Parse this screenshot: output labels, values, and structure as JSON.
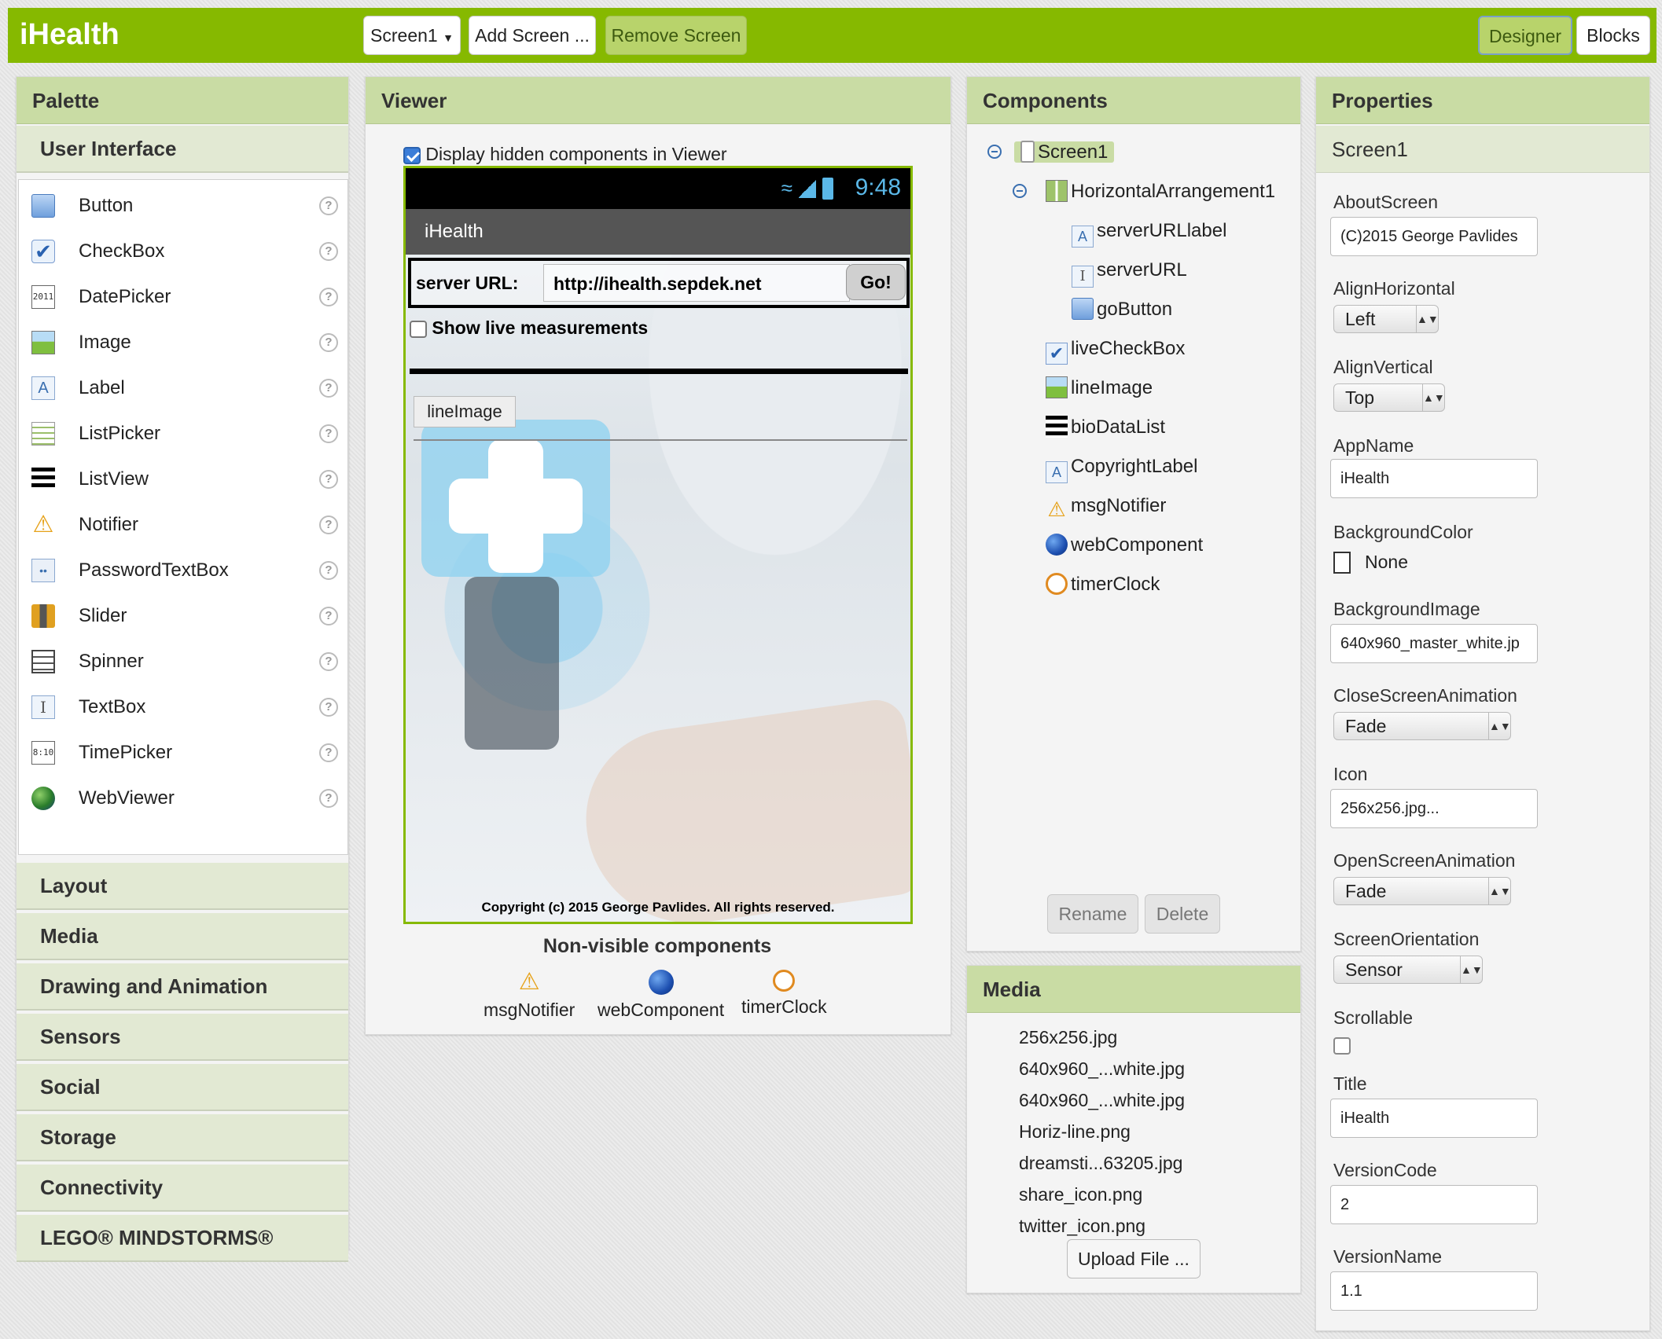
{
  "header": {
    "app_title": "iHealth",
    "screen_dropdown": "Screen1",
    "add_screen": "Add Screen ...",
    "remove_screen": "Remove Screen",
    "designer": "Designer",
    "blocks": "Blocks",
    "bar_color": "#86b900"
  },
  "palette": {
    "title": "Palette",
    "open_category": "User Interface",
    "items": [
      {
        "label": "Button",
        "icon": "button-icon"
      },
      {
        "label": "CheckBox",
        "icon": "checkbox-icon"
      },
      {
        "label": "DatePicker",
        "icon": "datepicker-icon"
      },
      {
        "label": "Image",
        "icon": "image-icon"
      },
      {
        "label": "Label",
        "icon": "label-icon"
      },
      {
        "label": "ListPicker",
        "icon": "listpicker-icon"
      },
      {
        "label": "ListView",
        "icon": "listview-icon"
      },
      {
        "label": "Notifier",
        "icon": "notifier-icon"
      },
      {
        "label": "PasswordTextBox",
        "icon": "password-icon"
      },
      {
        "label": "Slider",
        "icon": "slider-icon"
      },
      {
        "label": "Spinner",
        "icon": "spinner-icon"
      },
      {
        "label": "TextBox",
        "icon": "textbox-icon"
      },
      {
        "label": "TimePicker",
        "icon": "timepicker-icon"
      },
      {
        "label": "WebViewer",
        "icon": "webviewer-icon"
      }
    ],
    "help_glyph": "?",
    "categories": [
      "Layout",
      "Media",
      "Drawing and Animation",
      "Sensors",
      "Social",
      "Storage",
      "Connectivity",
      "LEGO® MINDSTORMS®"
    ]
  },
  "viewer": {
    "title": "Viewer",
    "display_hidden": "Display hidden components in Viewer",
    "phone": {
      "time": "9:48",
      "title": "iHealth",
      "server_label": "server URL:",
      "server_url": "http://ihealth.sepdek.net",
      "go": "Go!",
      "live": "Show live measurements",
      "line_image": "lineImage",
      "copyright": "Copyright (c) 2015 George Pavlides. All rights reserved."
    },
    "nonvisible_title": "Non-visible components",
    "nonvisible": [
      "msgNotifier",
      "webComponent",
      "timerClock"
    ]
  },
  "components": {
    "title": "Components",
    "tree": [
      "Screen1",
      "HorizontalArrangement1",
      "serverURLlabel",
      "serverURL",
      "goButton",
      "liveCheckBox",
      "lineImage",
      "bioDataList",
      "CopyrightLabel",
      "msgNotifier",
      "webComponent",
      "timerClock"
    ],
    "rename": "Rename",
    "delete": "Delete"
  },
  "media": {
    "title": "Media",
    "files": [
      "256x256.jpg",
      "640x960_...white.jpg",
      "640x960_...white.jpg",
      "Horiz-line.png",
      "dreamsti...63205.jpg",
      "share_icon.png",
      "twitter_icon.png"
    ],
    "upload": "Upload File ..."
  },
  "properties": {
    "title": "Properties",
    "subject": "Screen1",
    "about_label": "AboutScreen",
    "about_value": "(C)2015 George Pavlides",
    "alignh_label": "AlignHorizontal",
    "alignh_value": "Left",
    "alignv_label": "AlignVertical",
    "alignv_value": "Top",
    "appname_label": "AppName",
    "appname_value": "iHealth",
    "bgcolor_label": "BackgroundColor",
    "bgcolor_value": "None",
    "bgimage_label": "BackgroundImage",
    "bgimage_value": "640x960_master_white.jp",
    "closeanim_label": "CloseScreenAnimation",
    "closeanim_value": "Fade",
    "icon_label": "Icon",
    "icon_value": "256x256.jpg...",
    "openanim_label": "OpenScreenAnimation",
    "openanim_value": "Fade",
    "orient_label": "ScreenOrientation",
    "orient_value": "Sensor",
    "scrollable_label": "Scrollable",
    "title_label": "Title",
    "title_value": "iHealth",
    "vcode_label": "VersionCode",
    "vcode_value": "2",
    "vname_label": "VersionName",
    "vname_value": "1.1"
  }
}
